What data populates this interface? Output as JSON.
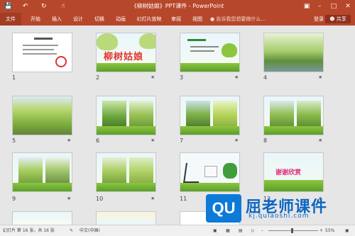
{
  "titlebar": {
    "title": "《柳树姑娘》PPT课件 - PowerPoint",
    "save_icon": "save-icon",
    "undo_icon": "undo-icon",
    "redo_icon": "redo-icon",
    "touch_icon": "touch-mode-icon",
    "window_controls": [
      "restore-ribbon-icon",
      "minimize-icon",
      "maximize-icon",
      "close-icon"
    ]
  },
  "ribbon": {
    "tabs": [
      "文件",
      "开始",
      "插入",
      "设计",
      "切换",
      "动画",
      "幻灯片放映",
      "审阅",
      "视图"
    ],
    "tell_me": "告诉我您想要做什么...",
    "login": "登录",
    "share": "共享"
  },
  "slides": [
    {
      "number": "1",
      "star": ""
    },
    {
      "number": "2",
      "star": "★",
      "title": "柳树姑娘"
    },
    {
      "number": "3",
      "star": "★"
    },
    {
      "number": "4",
      "star": "★"
    },
    {
      "number": "5",
      "star": "★"
    },
    {
      "number": "6",
      "star": "★"
    },
    {
      "number": "7",
      "star": "★"
    },
    {
      "number": "8",
      "star": "★"
    },
    {
      "number": "9",
      "star": "★"
    },
    {
      "number": "10",
      "star": "★"
    },
    {
      "number": "11",
      "star": "★"
    },
    {
      "number": "12",
      "star": "★",
      "title": "谢谢欣赏"
    }
  ],
  "statusbar": {
    "slide_info": "幻灯片 第 16 张，共 16 张",
    "language": "中文(中国)",
    "zoom": "55%"
  },
  "watermark": {
    "logo": "QU",
    "brand": "屈老师课件",
    "url": "kj.qulaoshi.com"
  },
  "colors": {
    "accent": "#b7472a",
    "background": "#e6e6e6",
    "watermark_blue": "#0d66c2"
  }
}
